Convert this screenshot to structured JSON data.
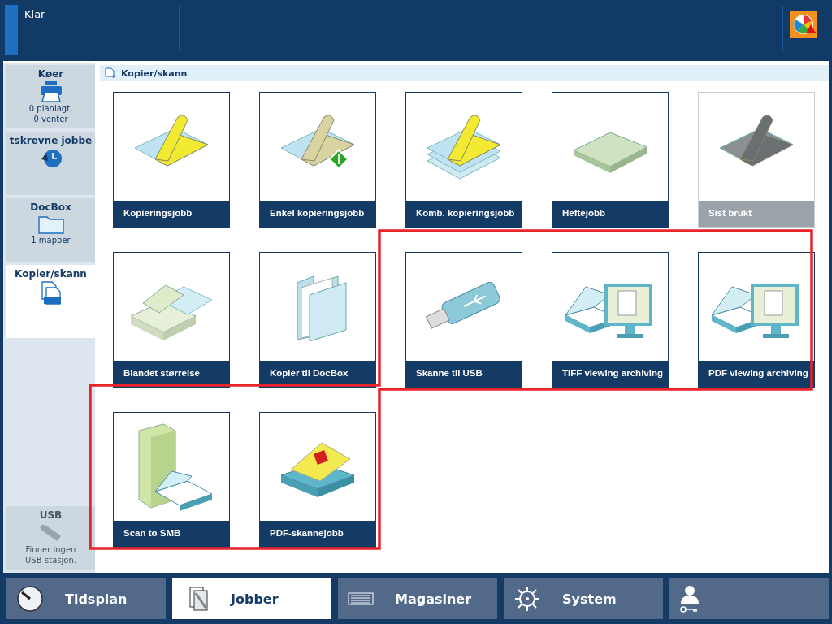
{
  "status": {
    "text": "Klar"
  },
  "breadcrumb": "Kopier/skann",
  "sidebar": {
    "items": [
      {
        "kind": "queue",
        "label": "Køer",
        "lines": [
          "0 planlagt,",
          "0 venter"
        ],
        "selected": false
      },
      {
        "kind": "history",
        "label": "tskrevne jobbe",
        "selected": false
      },
      {
        "kind": "docbox",
        "label": "DocBox",
        "lines": [
          "1 mapper"
        ],
        "selected": false
      },
      {
        "kind": "copyscan",
        "label": "Kopier/skann",
        "selected": true
      }
    ],
    "usb": {
      "label": "USB",
      "lines": [
        "Finner ingen",
        "USB-stasjon."
      ],
      "disabled": true
    }
  },
  "tiles": [
    {
      "kind": "copy",
      "label": "Kopieringsjobb",
      "disabled": false
    },
    {
      "kind": "copy-simple",
      "label": "Enkel kopieringsjobb",
      "disabled": false
    },
    {
      "kind": "copy-combined",
      "label": "Komb. kopieringsjobb",
      "disabled": false
    },
    {
      "kind": "booklet",
      "label": "Heftejobb",
      "disabled": false
    },
    {
      "kind": "recent",
      "label": "Sist brukt",
      "disabled": true
    },
    {
      "kind": "mixed",
      "label": "Blandet størrelse",
      "disabled": false
    },
    {
      "kind": "docbox",
      "label": "Kopier til DocBox",
      "disabled": false
    },
    {
      "kind": "usb",
      "label": "Skanne til USB",
      "disabled": false
    },
    {
      "kind": "monitor",
      "label": "TIFF viewing archiving",
      "disabled": false
    },
    {
      "kind": "monitor",
      "label": "PDF viewing archiving",
      "disabled": false
    },
    {
      "kind": "server",
      "label": "Scan to SMB",
      "disabled": false
    },
    {
      "kind": "pdf",
      "label": "PDF-skannejobb",
      "disabled": false
    }
  ],
  "nav": [
    {
      "kind": "clock",
      "label": "Tidsplan",
      "selected": false
    },
    {
      "kind": "jobs",
      "label": "Jobber",
      "selected": true
    },
    {
      "kind": "trays",
      "label": "Magasiner",
      "selected": false
    },
    {
      "kind": "system",
      "label": "System",
      "selected": false
    },
    {
      "kind": "user",
      "selected": false
    }
  ]
}
